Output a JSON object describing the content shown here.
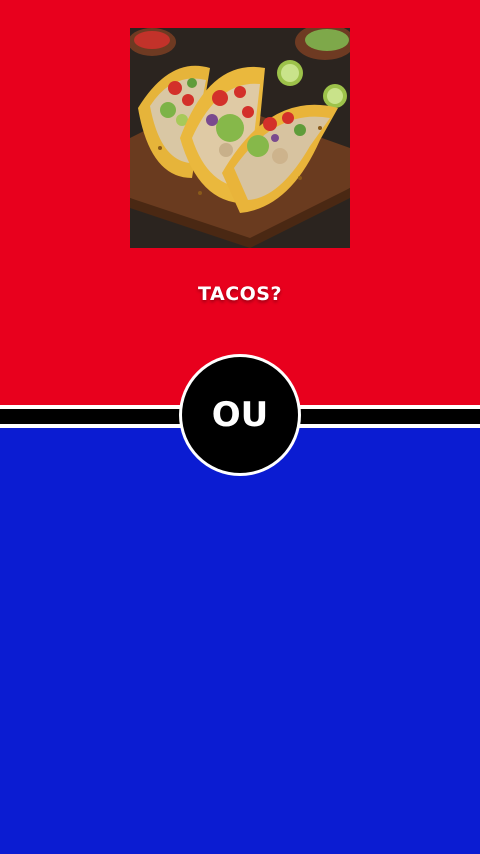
{
  "top_option": {
    "image_name": "tacos-photo",
    "label": "TACOS?",
    "background_color": "#e8001d"
  },
  "divider": {
    "label": "OU"
  },
  "bottom_option": {
    "background_color": "#0b1cd2"
  }
}
